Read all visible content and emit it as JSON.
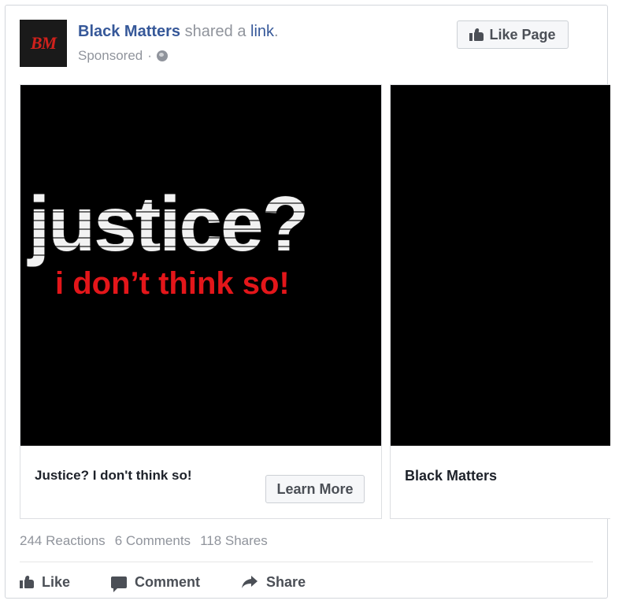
{
  "post": {
    "avatar_text": "BM",
    "page_name": "Black Matters",
    "shared_text": " shared a ",
    "link_word": "link",
    "period": ".",
    "sponsored": "Sponsored",
    "meta_dot": "·",
    "like_page_label": "Like Page"
  },
  "carousel": {
    "cards": [
      {
        "image_text_main": "justice?",
        "image_text_sub": "i don’t think so!",
        "title": "Justice? I don't think so!",
        "cta_label": "Learn More"
      },
      {
        "title": "Black Matters"
      }
    ]
  },
  "stats": {
    "reactions": "244 Reactions",
    "comments": "6 Comments",
    "shares": "118 Shares"
  },
  "actions": {
    "like": "Like",
    "comment": "Comment",
    "share": "Share"
  },
  "colors": {
    "link_blue": "#365899",
    "muted_gray": "#90949c",
    "button_text": "#4b4f56",
    "image_red": "#e3161a"
  }
}
